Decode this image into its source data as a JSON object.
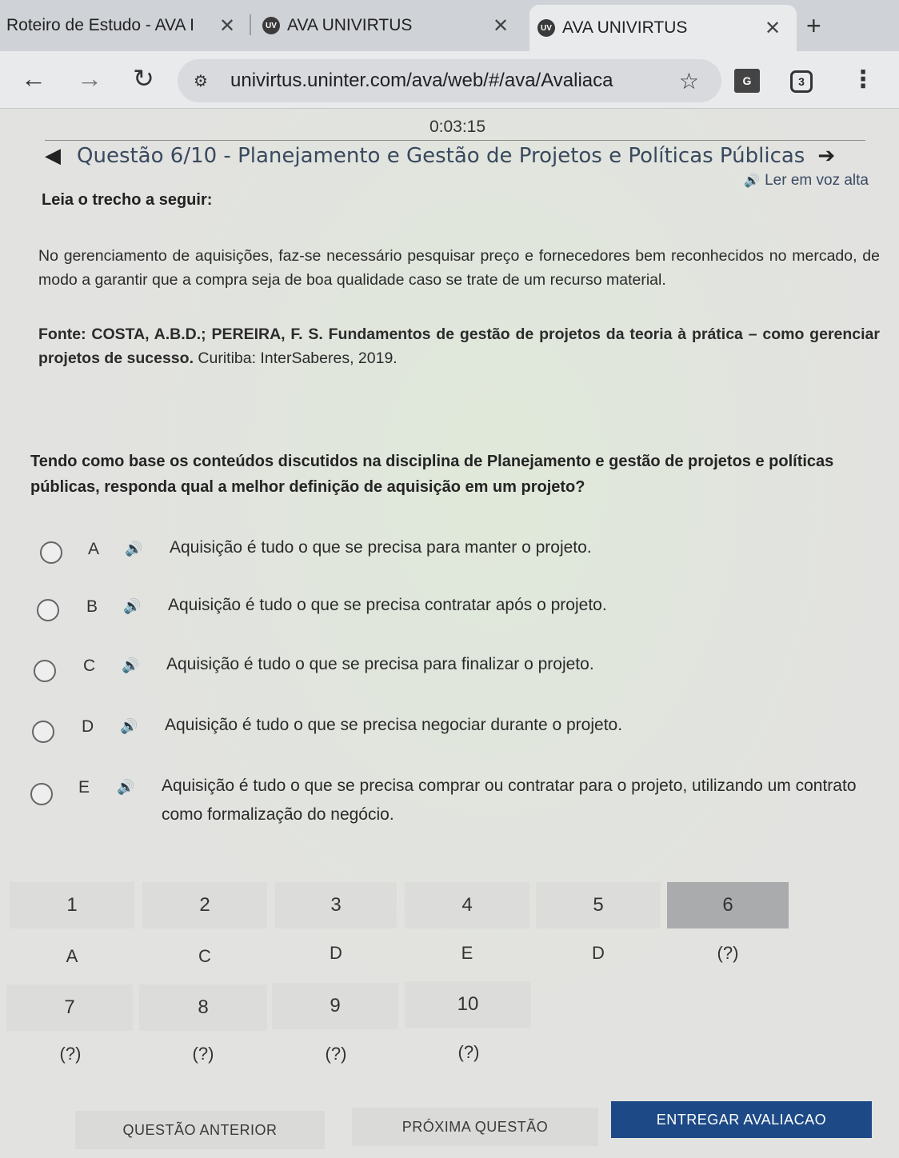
{
  "browser": {
    "tabs": [
      {
        "title": "Roteiro de Estudo - AVA I",
        "favicon": "",
        "active": false
      },
      {
        "title": "AVA UNIVIRTUS",
        "favicon": "UV",
        "active": false
      },
      {
        "title": "AVA UNIVIRTUS",
        "favicon": "UV",
        "active": true
      }
    ],
    "new_tab": "+",
    "url": "univirtus.uninter.com/ava/web/#/ava/Avaliaca",
    "extension_count": "3",
    "translate_label": "G"
  },
  "page": {
    "timer": "0:03:15",
    "question_title": "Questão 6/10 - Planejamento e Gestão de Projetos e Políticas Públicas",
    "read_aloud": "Ler em voz alta",
    "lead": "Leia o trecho a seguir:",
    "excerpt": "No gerenciamento de aquisições, faz-se necessário pesquisar preço e fornecedores bem reconhecidos no mercado, de modo a garantir que a compra seja de boa qualidade caso se trate de um recurso material.",
    "source_prefix": "Fonte: COSTA, A.B.D.; PEREIRA, F. S.",
    "source_title": "Fundamentos de gestão de projetos da teoria à prática – como gerenciar projetos de sucesso.",
    "source_suffix": "Curitiba: InterSaberes, 2019.",
    "question": "Tendo como base os conteúdos discutidos na disciplina de Planejamento e gestão de projetos e políticas públicas, responda qual a melhor definição de aquisição em um projeto?",
    "options": [
      {
        "letter": "A",
        "text": "Aquisição é tudo o que se precisa para manter o projeto."
      },
      {
        "letter": "B",
        "text": "Aquisição é tudo o que se precisa contratar após o projeto."
      },
      {
        "letter": "C",
        "text": "Aquisição é tudo o que se precisa para finalizar o projeto."
      },
      {
        "letter": "D",
        "text": "Aquisição é tudo o que se precisa negociar durante o projeto."
      },
      {
        "letter": "E",
        "text": "Aquisição é tudo o que se precisa comprar ou contratar para o projeto, utilizando um contrato como formalização do negócio."
      }
    ],
    "navigator": [
      {
        "number": "1",
        "answer": "A"
      },
      {
        "number": "2",
        "answer": "C"
      },
      {
        "number": "3",
        "answer": "D"
      },
      {
        "number": "4",
        "answer": "E"
      },
      {
        "number": "5",
        "answer": "D"
      },
      {
        "number": "6",
        "answer": "(?)",
        "current": true
      },
      {
        "number": "7",
        "answer": "(?)"
      },
      {
        "number": "8",
        "answer": "(?)"
      },
      {
        "number": "9",
        "answer": "(?)"
      },
      {
        "number": "10",
        "answer": "(?)"
      }
    ],
    "buttons": {
      "previous": "QUESTÃO ANTERIOR",
      "next": "PRÓXIMA QUESTÃO",
      "submit": "ENTREGAR AVALIACAO"
    }
  },
  "colors": {
    "title": "#39495e",
    "submit_button": "#1d4a86",
    "active_cell": "#a9abad"
  }
}
